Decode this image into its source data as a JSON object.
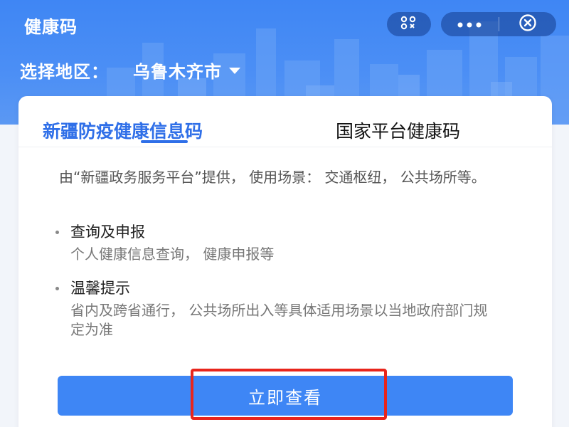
{
  "header": {
    "title": "健康码"
  },
  "capsule": {
    "scan_icon": "scan-code-icon",
    "more_icon": "more-dots-icon",
    "close_icon": "close-circle-icon"
  },
  "region": {
    "label": "选择地区：",
    "value": "乌鲁木齐市"
  },
  "tabs": [
    {
      "label": "新疆防疫健康信息码",
      "active": true
    },
    {
      "label": "国家平台健康码",
      "active": false
    }
  ],
  "intro": "由“新疆政务服务平台”提供， 使用场景： 交通枢纽， 公共场所等。",
  "sections": [
    {
      "title": "查询及申报",
      "body": "个人健康信息查询， 健康申报等"
    },
    {
      "title": "温馨提示",
      "body": "省内及跨省通行， 公共场所出入等具体适用场景以当地政府部门规定为准"
    }
  ],
  "cta": {
    "label": "立即查看"
  },
  "colors": {
    "brand_blue": "#3e86f5",
    "active_tab": "#2f6fe8",
    "highlight_red": "#e8251c"
  }
}
